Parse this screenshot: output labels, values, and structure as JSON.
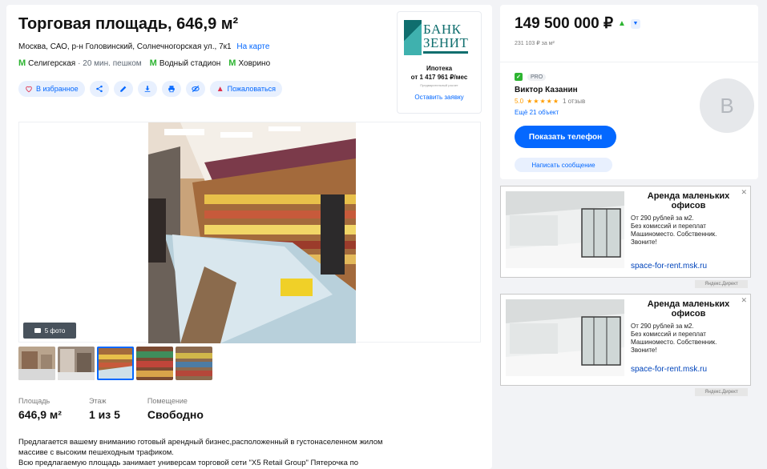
{
  "listing": {
    "title": "Торговая площадь, 646,9 м²",
    "address": "Москва, САО, р-н Головинский, Солнечногорская ул., 7к1",
    "map_link": "На карте",
    "metro": [
      {
        "name": "Селигерская",
        "time": "· 20 мин. пешком"
      },
      {
        "name": "Водный стадион",
        "time": ""
      },
      {
        "name": "Ховрино",
        "time": ""
      }
    ],
    "metro_color": "#2db431"
  },
  "actions": {
    "favorite": "В избранное",
    "complain": "Пожаловаться",
    "icons": [
      "share-icon",
      "edit-icon",
      "download-icon",
      "print-icon",
      "hide-icon"
    ]
  },
  "bank": {
    "name_line1": "БАНК",
    "name_line2": "ЗЕНИТ",
    "mortgage_label": "Ипотека",
    "mortgage_amount": "от 1 417 961 ₽/мес",
    "note": "Предварительный расчет",
    "apply": "Оставить заявку"
  },
  "gallery": {
    "photo_count": "5 фото",
    "thumbnails": 5,
    "active_thumbnail": 3
  },
  "facts": [
    {
      "label": "Площадь",
      "value": "646,9 м²"
    },
    {
      "label": "Этаж",
      "value": "1 из 5"
    },
    {
      "label": "Помещение",
      "value": "Свободно"
    }
  ],
  "description": [
    "Предлагается вашему вниманию готовый арендный бизнес,расположенный в густонаселенном жилом",
    "массиве с высоким пешеходным трафиком.",
    "Всю предлагаемую площадь занимает универсам торговой сети \"X5 Retail Group\" Пятерочка по"
  ],
  "seller": {
    "price": "149 500 000 ₽",
    "price_per_sqm": "231 103 ₽ за м²",
    "pro_label": "PRO",
    "agent_name": "Виктор Казанин",
    "rating": "5.0",
    "stars": "★★★★★",
    "reviews": "1 отзыв",
    "more_objects": "Ещё 21 объект",
    "avatar_letter": "В",
    "phone_button": "Показать телефон",
    "message_button": "Написать сообщение"
  },
  "ads": [
    {
      "title": "Аренда маленьких офисов",
      "lines": [
        "От 290 рублей за м2.",
        "Без комиссий и переплат",
        "Машиноместо. Собственник.",
        "Звоните!"
      ],
      "link": "space-for-rent.msk.ru",
      "label": "Яндекс.Директ"
    },
    {
      "title": "Аренда маленьких офисов",
      "lines": [
        "От 290 рублей за м2.",
        "Без комиссий и переплат",
        "Машиноместо. Собственник.",
        "Звоните!"
      ],
      "link": "space-for-rent.msk.ru",
      "label": "Яндекс.Директ"
    }
  ],
  "colors": {
    "accent": "#0468ff",
    "price_up": "#2db431",
    "danger": "#e02f4b"
  }
}
